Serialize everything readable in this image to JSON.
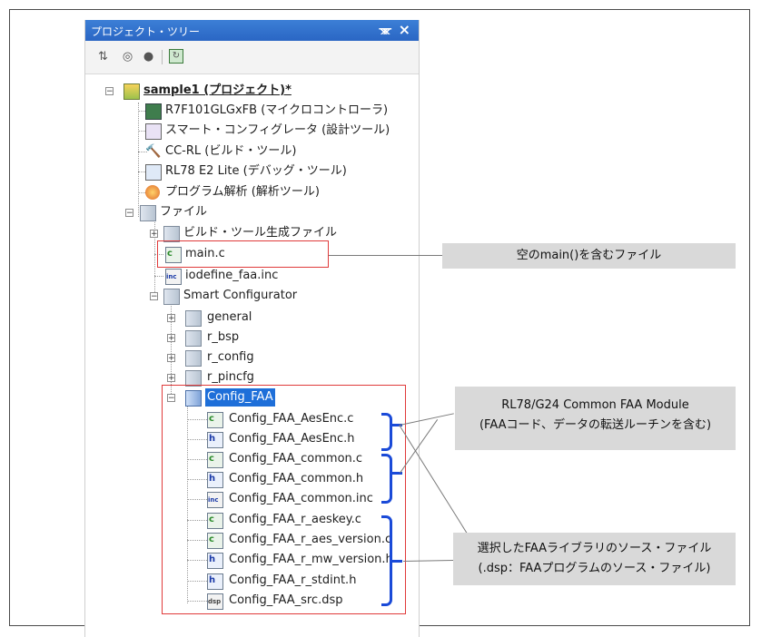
{
  "panel": {
    "title": "プロジェクト・ツリー",
    "pin_icon": "pin-icon",
    "close_icon": "close-icon",
    "toolbar": [
      "sort-icon",
      "properties-icon",
      "user-icon",
      "refresh-icon"
    ]
  },
  "tree": {
    "project": "sample1 (プロジェクト)*",
    "device": "R7F101GLGxFB (マイクロコントローラ)",
    "smart_config": "スマート・コンフィグレータ (設計ツール)",
    "build_tool": "CC-RL (ビルド・ツール)",
    "debug_tool": "RL78 E2 Lite (デバッグ・ツール)",
    "analysis": "プログラム解析 (解析ツール)",
    "files": "ファイル",
    "build_gen": "ビルド・ツール生成ファイル",
    "main_c": "main.c",
    "iodefine": "iodefine_faa.inc",
    "sc_folder": "Smart Configurator",
    "general": "general",
    "r_bsp": "r_bsp",
    "r_config": "r_config",
    "r_pincfg": "r_pincfg",
    "config_faa": "Config_FAA",
    "f1": "Config_FAA_AesEnc.c",
    "f2": "Config_FAA_AesEnc.h",
    "f3": "Config_FAA_common.c",
    "f4": "Config_FAA_common.h",
    "f5": "Config_FAA_common.inc",
    "f6": "Config_FAA_r_aeskey.c",
    "f7": "Config_FAA_r_aes_version.c",
    "f8": "Config_FAA_r_mw_version.h",
    "f9": "Config_FAA_r_stdint.h",
    "f10": "Config_FAA_src.dsp"
  },
  "callouts": {
    "main": "空のmain()を含むファイル",
    "module_line1": "RL78/G24 Common FAA Module",
    "module_line2": "(FAAコード、データの転送ルーチンを含む)",
    "source_line1": "選択したFAAライブラリのソース・ファイル",
    "source_line2": "(.dsp：FAAプログラムのソース・ファイル)"
  },
  "colors": {
    "selection": "#1e6fd9",
    "highlight_box": "#e03a3a",
    "bracket": "#1a4ad8",
    "callout_bg": "#d9d9d9"
  }
}
